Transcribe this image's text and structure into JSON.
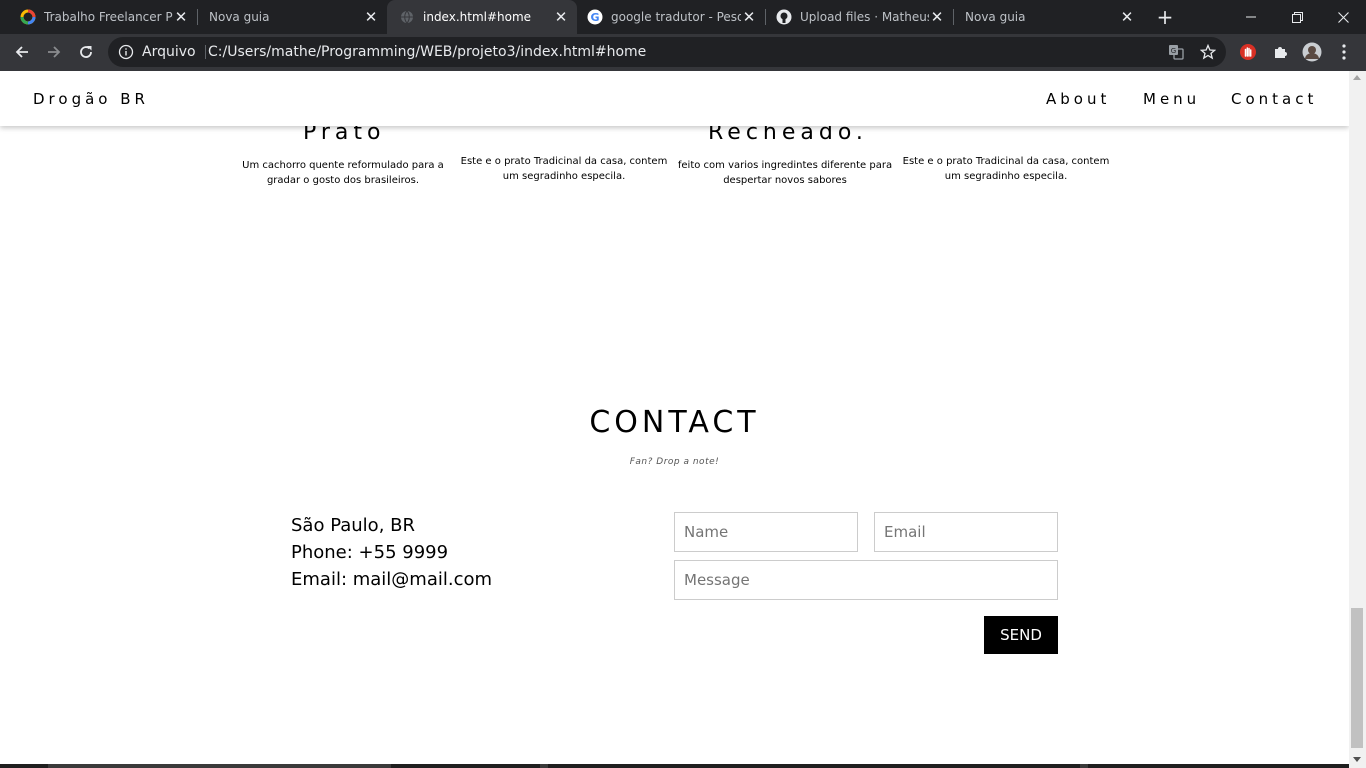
{
  "browser": {
    "tabs": [
      {
        "title": "Trabalho Freelancer Por",
        "active": false
      },
      {
        "title": "Nova guia",
        "active": false
      },
      {
        "title": "index.html#home",
        "active": true
      },
      {
        "title": "google tradutor - Pesqu",
        "active": false
      },
      {
        "title": "Upload files · Matheus-",
        "active": false
      },
      {
        "title": "Nova guia",
        "active": false
      }
    ],
    "close_glyph": "✕",
    "new_tab_glyph": "+",
    "omnibox": {
      "scheme_label": "Arquivo",
      "url": "C:/Users/mathe/Programming/WEB/projeto3/index.html#home"
    }
  },
  "site": {
    "brand": "Drogão BR",
    "nav": [
      "About",
      "Menu",
      "Contact"
    ]
  },
  "dishes": {
    "items": [
      {
        "title": "Prato",
        "description_lines": [
          "Um cachorro quente reformulado para a",
          "gradar o gosto dos brasileiros."
        ]
      },
      {
        "title": "",
        "description_lines": [
          "Este e o prato Tradicinal da casa, contem",
          "um segradinho especila."
        ]
      },
      {
        "title": "Recheado.",
        "description_lines": [
          "feito com varios ingredintes diferente para",
          "despertar novos sabores"
        ]
      },
      {
        "title": "",
        "description_lines": [
          "Este e o prato Tradicinal da casa, contem",
          "um segradinho especila."
        ]
      }
    ]
  },
  "contact": {
    "title": "CONTACT",
    "subtitle": "Fan? Drop a note!",
    "info": [
      "São Paulo, BR",
      "Phone: +55 9999",
      "Email: mail@mail.com"
    ],
    "form": {
      "name_placeholder": "Name",
      "email_placeholder": "Email",
      "message_placeholder": "Message",
      "send_label": "SEND"
    }
  },
  "colors": {
    "chrome_dark": "#202124",
    "chrome_toolbar": "#35363a",
    "accent_red": "#d93025",
    "button_black": "#000000"
  }
}
